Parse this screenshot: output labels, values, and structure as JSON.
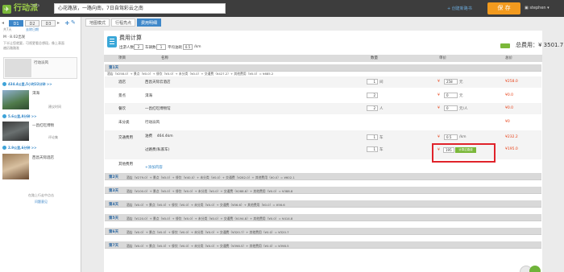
{
  "header": {
    "logo_text": "行动派",
    "logo_small": "beta",
    "trip_title": "心花路放，一路向南，7日自驾彩云之南",
    "new_trip_link": "+ 创建新路书",
    "save_label": "保 存",
    "user_name": "stephen"
  },
  "sidebar": {
    "day_tabs": [
      "D1",
      "D2",
      "D3"
    ],
    "day_count_label": "共7天",
    "sub_link": "去除日期",
    "intro_title": "M · 8.02出发",
    "intro_desc_1": "下半让您就要，可视更看总想段，像上表面",
    "intro_desc_2": "遍历路路准",
    "card1_title": "行动派风",
    "card1_sub": "",
    "route1": "434.4公里,5小时22分钟 >>",
    "card2_title": "洱海",
    "card2_sub": "建议时间",
    "route2": "5.6公里,8分钟 >>",
    "card3_title": "一昌红吃博物",
    "card3_sub": "评论集",
    "route3": "2.9公里,6分钟 >>",
    "card4_title": "西昌天际酒店",
    "card4_sub": "",
    "bottom_text": "在路上行走中点击",
    "bottom_link": "问题意见"
  },
  "view_tabs": [
    "地图模式",
    "行程亮点",
    "费用明细"
  ],
  "cost": {
    "title": "费用计算",
    "people_label": "出游人数",
    "people_value": "2",
    "cars_label": "车辆数",
    "cars_value": "1",
    "fuel_label": "平均油耗",
    "fuel_value": "0.5",
    "fuel_unit": "/km",
    "total_label": "总费用：¥ 3501.7",
    "columns": [
      "项目",
      "名称",
      "数量",
      "单价",
      "总价"
    ],
    "day1": {
      "label": "第1天",
      "summary": "酒店（¥258.0）+ 景点（¥0.0）+ 餐饮（¥0.0）+ 未分类（¥0.0）+ 交通费（¥427.2）+ 其他费用（¥0.0）= ¥685.2",
      "rows": [
        {
          "category": "酒店",
          "name": "西昌天际云酒店",
          "qty": "1",
          "unit": "间",
          "price": "258",
          "price_unit": "元",
          "total": "¥258.0"
        },
        {
          "category": "景点",
          "name": "洱海",
          "qty": "2",
          "unit": "",
          "price": "0",
          "price_unit": "元",
          "total": "¥0.0"
        },
        {
          "category": "餐饮",
          "name": "一昌红吃博物馆",
          "qty": "2",
          "unit": "人",
          "price": "0",
          "price_unit": "元/人",
          "total": "¥0.0"
        },
        {
          "category": "未分类",
          "name": "行动派风",
          "qty": "",
          "unit": "",
          "price": "",
          "price_unit": "",
          "total": "¥0"
        },
        {
          "category": "交通费用",
          "name": "油费    464.4km",
          "qty": "1",
          "unit": "车",
          "price": "0.5",
          "price_unit": "/km",
          "total": "¥232.2"
        },
        {
          "category": "",
          "name": "过路费(私家车)",
          "qty": "1",
          "unit": "车",
          "price": "195",
          "price_unit": "",
          "total": "¥195.0"
        },
        {
          "category": "其他费用",
          "name": "+添加内容",
          "qty": "",
          "unit": "",
          "price": "",
          "price_unit": "",
          "total": ""
        }
      ],
      "price_btn_label": "计算过路费"
    },
    "other_days": [
      {
        "label": "第2天",
        "summary": "酒店（¥279.0）+ 景点（¥0.0）+ 餐饮（¥40.0）+ 未分类（¥0.0）+ 交通费（¥282.0）+ 其他费用（¥0.0）= ¥602.1"
      },
      {
        "label": "第3天",
        "summary": "酒店（¥100.0）+ 景点（¥0.0）+ 餐饮（¥0.0）+ 未分类（¥0.0）+ 交通费（¥288.8）+ 其他费用（¥0.0）= ¥388.8"
      },
      {
        "label": "第4天",
        "summary": "酒店（¥0.0）+ 景点（¥0.0）+ 餐饮（¥0.0）+ 未分类（¥0.0）+ 交通费（¥56.6）+ 其他费用（¥0.0）= ¥56.6"
      },
      {
        "label": "第5天",
        "summary": "酒店（¥120.0）+ 景点（¥0.0）+ 餐饮（¥0.0）+ 未分类（¥0.0）+ 交通费（¥194.8）+ 其他费用（¥0.0）= ¥414.8"
      },
      {
        "label": "第6天",
        "summary": "酒店（¥0.0）+ 景点（¥0.0）+ 餐饮（¥0.0）+ 未分类（¥0.0）+ 交通费（¥320.7）+ 其他费用（¥0.0）= ¥320.7"
      },
      {
        "label": "第7天",
        "summary": "酒店（¥0.0）+ 景点（¥0.0）+ 餐饮（¥0.0）+ 未分类（¥0.0）+ 交通费（¥398.5）+ 其他费用（¥0.0）= ¥398.5"
      }
    ]
  },
  "colors": {
    "accent": "#3e87c9",
    "save": "#f29a1e",
    "price": "#e8431a",
    "highlight": "#e0232b"
  }
}
